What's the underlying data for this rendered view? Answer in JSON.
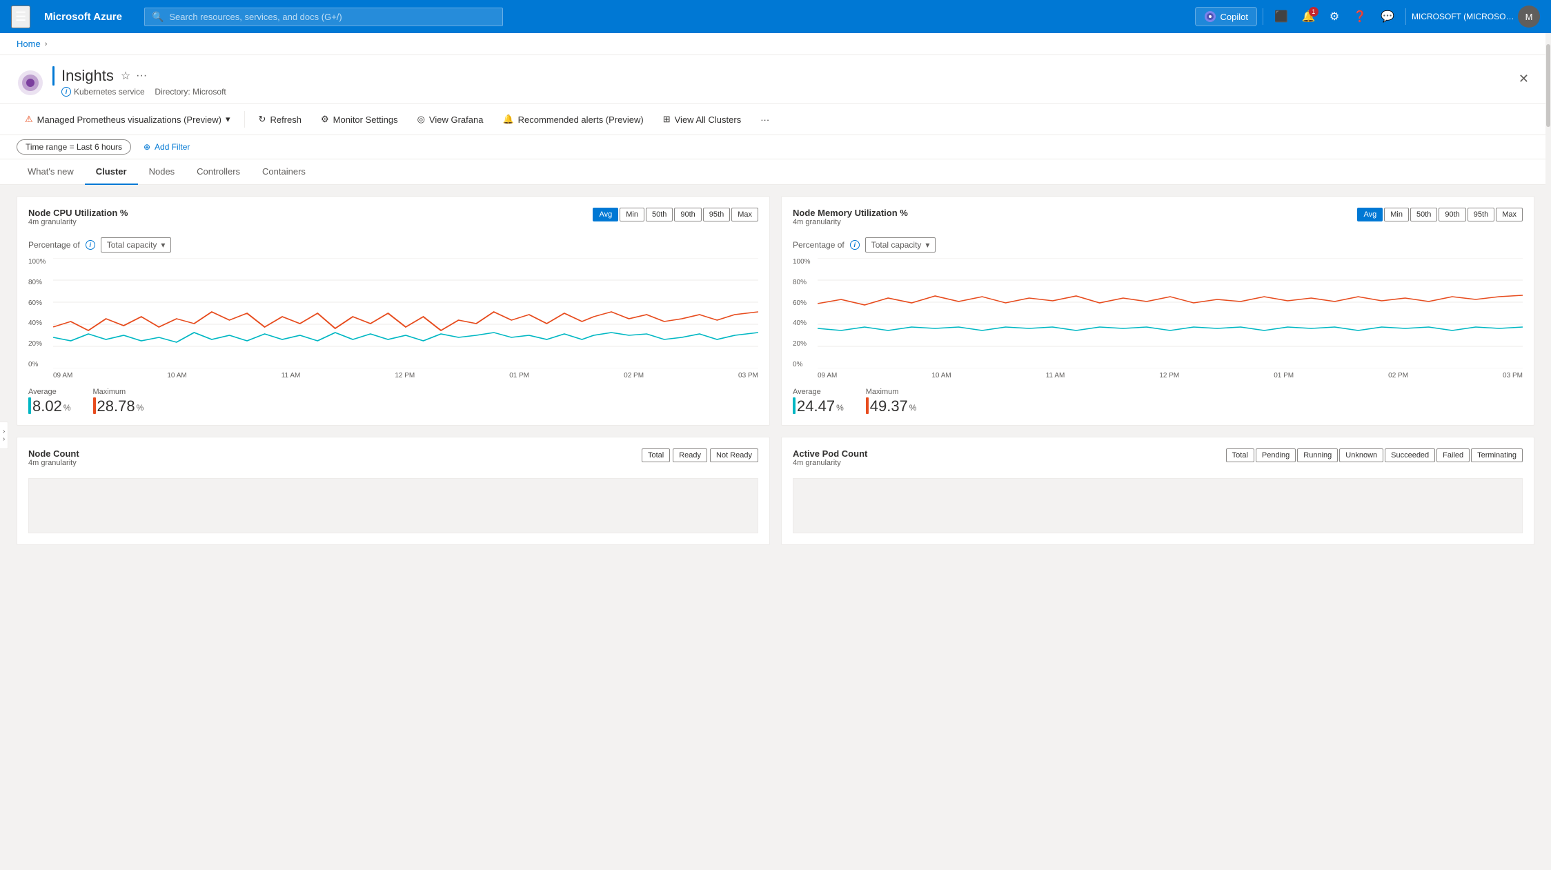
{
  "nav": {
    "hamburger_label": "☰",
    "brand": "Microsoft Azure",
    "search_placeholder": "Search resources, services, and docs (G+/)",
    "copilot_label": "Copilot",
    "notification_count": "1",
    "user_display": "MICROSOFT (MICROSOFT.ONMI...",
    "divider_char": "|"
  },
  "breadcrumb": {
    "home_label": "Home",
    "separator": "›"
  },
  "page": {
    "icon": "🟣",
    "service_type": "Kubernetes service",
    "directory_label": "Directory: Microsoft",
    "title": "Insights",
    "favorite_icon": "☆",
    "more_icon": "···",
    "close_icon": "✕"
  },
  "toolbar": {
    "managed_prometheus_label": "Managed Prometheus visualizations (Preview)",
    "dropdown_icon": "▾",
    "refresh_label": "Refresh",
    "monitor_settings_label": "Monitor Settings",
    "view_grafana_label": "View Grafana",
    "recommended_alerts_label": "Recommended alerts (Preview)",
    "view_all_clusters_label": "View All Clusters",
    "more_icon": "···"
  },
  "filters": {
    "time_range_label": "Time range = Last 6 hours",
    "add_filter_label": "Add Filter"
  },
  "tabs": [
    {
      "label": "What's new",
      "active": false
    },
    {
      "label": "Cluster",
      "active": true
    },
    {
      "label": "Nodes",
      "active": false
    },
    {
      "label": "Controllers",
      "active": false
    },
    {
      "label": "Containers",
      "active": false
    }
  ],
  "cpu_chart": {
    "title": "Node CPU Utilization %",
    "subtitle": "4m granularity",
    "buttons": [
      "Avg",
      "Min",
      "50th",
      "90th",
      "95th",
      "Max"
    ],
    "active_button": "Avg",
    "pct_of_label": "Percentage of",
    "info_icon": "i",
    "dropdown_label": "Total capacity",
    "y_labels": [
      "100%",
      "80%",
      "60%",
      "40%",
      "20%",
      "0%"
    ],
    "x_labels": [
      "09 AM",
      "10 AM",
      "11 AM",
      "12 PM",
      "01 PM",
      "02 PM",
      "03 PM"
    ],
    "avg_label": "Average",
    "avg_value": "8.02",
    "avg_unit": "%",
    "max_label": "Maximum",
    "max_value": "28.78",
    "max_unit": "%",
    "avg_color": "#00b7c3",
    "max_color": "#e74c1e"
  },
  "memory_chart": {
    "title": "Node Memory Utilization %",
    "subtitle": "4m granularity",
    "buttons": [
      "Avg",
      "Min",
      "50th",
      "90th",
      "95th",
      "Max"
    ],
    "active_button": "Avg",
    "pct_of_label": "Percentage of",
    "info_icon": "i",
    "dropdown_label": "Total capacity",
    "y_labels": [
      "100%",
      "80%",
      "60%",
      "40%",
      "20%",
      "0%"
    ],
    "x_labels": [
      "09 AM",
      "10 AM",
      "11 AM",
      "12 PM",
      "01 PM",
      "02 PM",
      "03 PM"
    ],
    "avg_label": "Average",
    "avg_value": "24.47",
    "avg_unit": "%",
    "max_label": "Maximum",
    "max_value": "49.37",
    "max_unit": "%",
    "avg_color": "#00b7c3",
    "max_color": "#e74c1e"
  },
  "node_count_chart": {
    "title": "Node Count",
    "subtitle": "4m granularity",
    "buttons": [
      "Total",
      "Ready",
      "Not Ready"
    ]
  },
  "active_pod_chart": {
    "title": "Active Pod Count",
    "subtitle": "4m granularity",
    "buttons": [
      "Total",
      "Pending",
      "Running",
      "Unknown",
      "Succeeded",
      "Failed",
      "Terminating"
    ]
  }
}
